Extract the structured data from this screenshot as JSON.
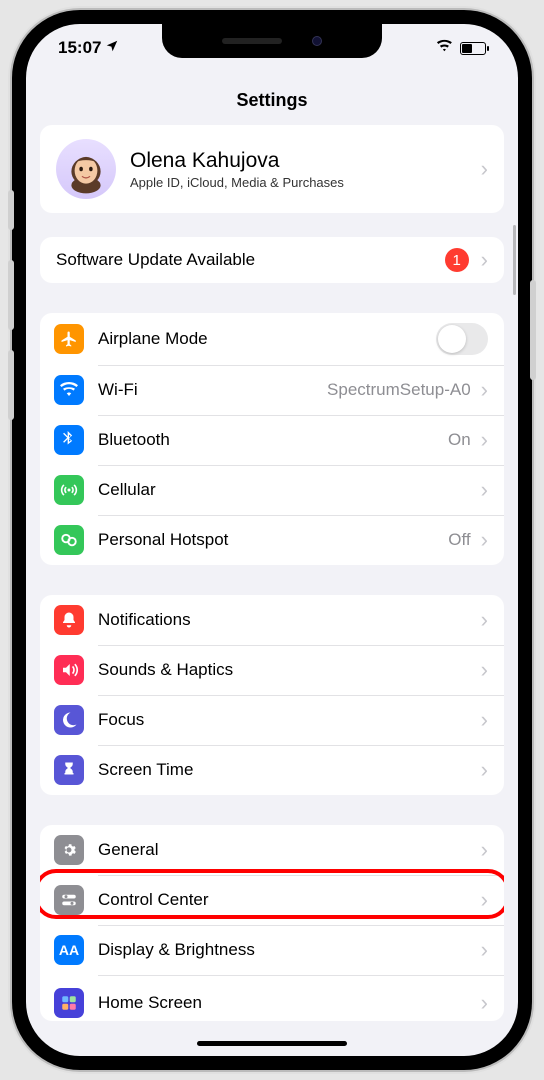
{
  "status": {
    "time": "15:07"
  },
  "title": "Settings",
  "profile": {
    "name": "Olena Kahujova",
    "sub": "Apple ID, iCloud, Media & Purchases"
  },
  "update": {
    "label": "Software Update Available",
    "badge": "1"
  },
  "group_conn": {
    "airplane": "Airplane Mode",
    "wifi": "Wi-Fi",
    "wifi_val": "SpectrumSetup-A0",
    "bt": "Bluetooth",
    "bt_val": "On",
    "cell": "Cellular",
    "hotspot": "Personal Hotspot",
    "hotspot_val": "Off"
  },
  "group_notif": {
    "notif": "Notifications",
    "sounds": "Sounds & Haptics",
    "focus": "Focus",
    "screentime": "Screen Time"
  },
  "group_gen": {
    "general": "General",
    "control": "Control Center",
    "display": "Display & Brightness",
    "home": "Home Screen"
  }
}
